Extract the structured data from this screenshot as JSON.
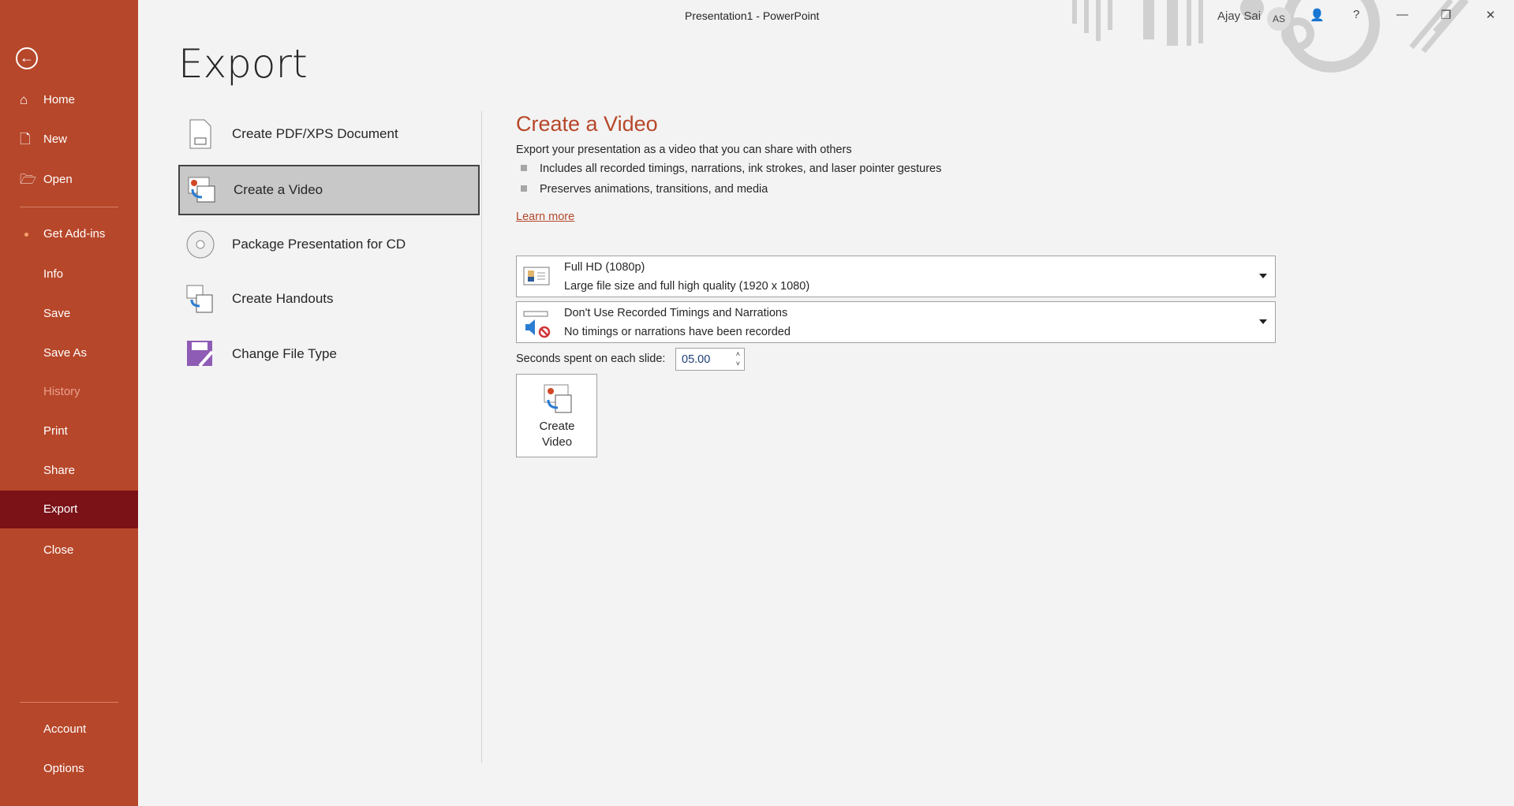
{
  "window": {
    "title": "Presentation1  -  PowerPoint",
    "user": "Ajay Sai",
    "initials": "AS"
  },
  "sidebar": {
    "items": [
      {
        "label": "Home",
        "icon": "home-icon"
      },
      {
        "label": "New",
        "icon": "new-file-icon"
      },
      {
        "label": "Open",
        "icon": "folder-open-icon"
      },
      {
        "label": "Get Add-ins"
      },
      {
        "label": "Info"
      },
      {
        "label": "Save"
      },
      {
        "label": "Save As"
      },
      {
        "label": "History",
        "disabled": true
      },
      {
        "label": "Print"
      },
      {
        "label": "Share"
      },
      {
        "label": "Export",
        "active": true
      },
      {
        "label": "Close"
      },
      {
        "label": "Account"
      },
      {
        "label": "Options"
      }
    ]
  },
  "page_title": "Export",
  "export_options": [
    "Create PDF/XPS Document",
    "Create a Video",
    "Package Presentation for CD",
    "Create Handouts",
    "Change File Type"
  ],
  "selected_option": "Create a Video",
  "panel": {
    "heading": "Create a Video",
    "description": "Export your presentation as a video that you can share with others",
    "bullets": [
      "Includes all recorded timings, narrations, ink strokes, and laser pointer gestures",
      "Preserves animations, transitions, and media"
    ],
    "learn_more": "Learn more",
    "quality": {
      "title": "Full HD (1080p)",
      "subtitle": "Large file size and full high quality (1920 x 1080)"
    },
    "timings": {
      "title": "Don't Use Recorded Timings and Narrations",
      "subtitle": "No timings or narrations have been recorded"
    },
    "seconds_label": "Seconds spent on each slide:",
    "seconds_value": "05.00",
    "create_button": "Create Video"
  },
  "colors": {
    "accent": "#b7472a",
    "active": "#7a1218"
  }
}
